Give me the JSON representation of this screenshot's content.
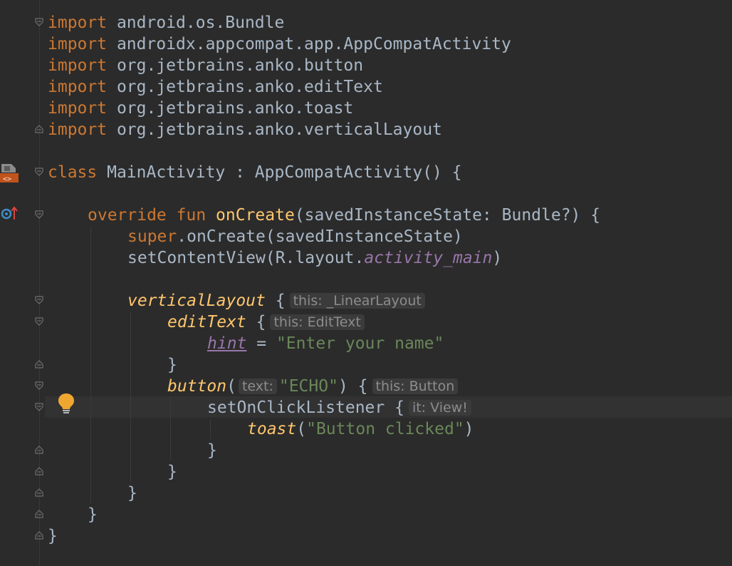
{
  "editor": {
    "colors": {
      "background": "#2b2b2b",
      "keyword": "#cc7832",
      "function": "#ffc66d",
      "string": "#6a8759",
      "resource": "#9876aa",
      "default_text": "#a9b7c6",
      "hint_background": "#3b3b3b",
      "hint_text": "#8c8c8c"
    },
    "gutter_icons": [
      "implemented-layout-icon",
      "override-up-arrow-icon",
      "intention-bulb-icon"
    ],
    "code": {
      "l1": {
        "kw": "import",
        "rest": " android.os.Bundle"
      },
      "l2": {
        "kw": "import",
        "rest": " androidx.appcompat.app.AppCompatActivity"
      },
      "l3": {
        "kw": "import",
        "rest": " org.jetbrains.anko.button"
      },
      "l4": {
        "kw": "import",
        "rest": " org.jetbrains.anko.editText"
      },
      "l5": {
        "kw": "import",
        "rest": " org.jetbrains.anko.toast"
      },
      "l6": {
        "kw": "import",
        "rest": " org.jetbrains.anko.verticalLayout"
      },
      "l8": {
        "kw": "class",
        "rest": " MainActivity : AppCompatActivity() {"
      },
      "l10": {
        "kw_override": "override",
        "kw_fun": "fun",
        "fn": "onCreate",
        "rest": "(savedInstanceState: Bundle?) {"
      },
      "l11": {
        "kw": "super",
        "rest": ".onCreate(savedInstanceState)"
      },
      "l12": {
        "pre": "setContentView(R.layout.",
        "res": "activity_main",
        "post": ")"
      },
      "l14": {
        "fn": "verticalLayout",
        "brace": " {",
        "hint": "this: _LinearLayout"
      },
      "l15": {
        "fn": "editText",
        "brace": " {",
        "hint": "this: EditText"
      },
      "l16": {
        "prop": "hint",
        "eq": " = ",
        "str": "\"Enter your name\""
      },
      "l17": {
        "text": "}"
      },
      "l18": {
        "fn": "button",
        "open": "(",
        "arg_hint": "text:",
        "str": "\"ECHO\"",
        "close": ") {",
        "hint": "this: Button"
      },
      "l19": {
        "text": "setOnClickListener {",
        "hint": "it: View!"
      },
      "l20": {
        "fn": "toast",
        "open": "(",
        "str": "\"Button clicked\"",
        "close": ")"
      },
      "l21": {
        "text": "}"
      },
      "l22": {
        "text": "}"
      },
      "l23": {
        "text": "}"
      },
      "l24": {
        "text": "}"
      },
      "l25": {
        "text": "}"
      }
    }
  }
}
